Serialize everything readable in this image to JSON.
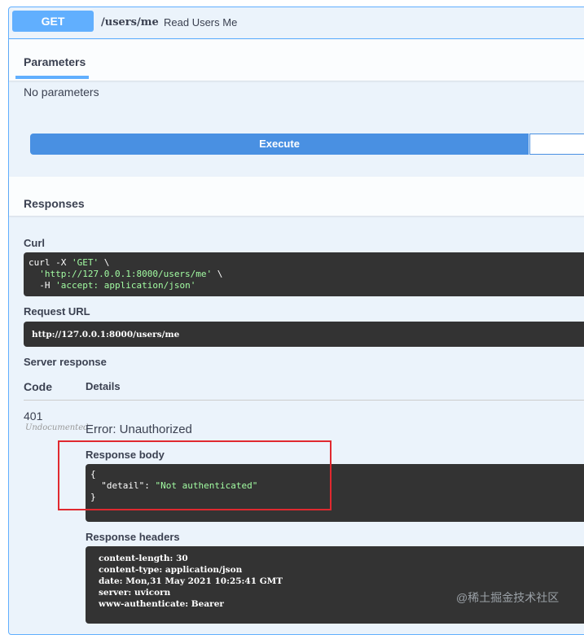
{
  "endpoint": {
    "method": "GET",
    "path": "/users/me",
    "summary": "Read Users Me"
  },
  "parameters": {
    "tab_label": "Parameters",
    "empty_text": "No parameters"
  },
  "actions": {
    "execute_label": "Execute"
  },
  "responses": {
    "title": "Responses",
    "curl_label": "Curl",
    "curl_lines": {
      "l1_cmd": "curl -X ",
      "l1_method": "'GET'",
      "l1_tail": " \\",
      "l2_url": "'http://127.0.0.1:8000/users/me'",
      "l2_tail": " \\",
      "l3_flag": "-H ",
      "l3_header": "'accept: application/json'"
    },
    "request_url_label": "Request URL",
    "request_url": "http://127.0.0.1:8000/users/me",
    "server_response_label": "Server response",
    "code_col": "Code",
    "details_col": "Details",
    "status_code": "401",
    "undocumented": "Undocumented",
    "error_text": "Error: Unauthorized",
    "body_label": "Response body",
    "body": {
      "open": "{",
      "key": "\"detail\"",
      "colon": ": ",
      "value": "\"Not authenticated\"",
      "close": "}"
    },
    "headers_label": "Response headers",
    "headers": [
      "content-length: 30",
      "content-type: application/json",
      "date: Mon,31 May 2021 10:25:41 GMT",
      "server: uvicorn",
      "www-authenticate: Bearer"
    ]
  },
  "watermark": "@稀土掘金技术社区",
  "colors": {
    "get_blue": "#61affe",
    "execute_blue": "#4990e2",
    "code_bg": "#333333",
    "string_green": "#a2fca2",
    "highlight_red": "#e0292f"
  }
}
